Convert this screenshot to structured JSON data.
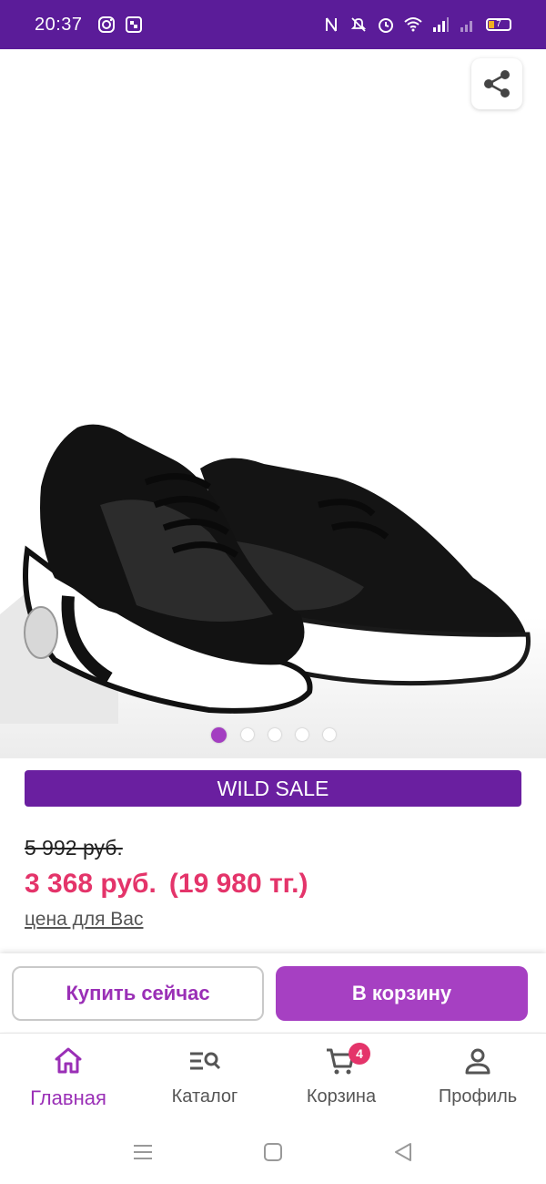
{
  "status_bar": {
    "time": "20:37",
    "battery": "7"
  },
  "sale_banner": {
    "label": "WILD SALE"
  },
  "pricing": {
    "old_price": "5 992 руб.",
    "price": "3 368 руб.",
    "price_tenge": "(19 980 тг.)",
    "note": "цена для Вас"
  },
  "gallery": {
    "slide_count": 5,
    "active_slide": 1
  },
  "actions": {
    "buy_now": "Купить сейчас",
    "add_to_cart": "В корзину"
  },
  "bottom_nav": {
    "items": [
      {
        "label": "Главная",
        "icon": "home-icon",
        "active": true
      },
      {
        "label": "Каталог",
        "icon": "catalog-search-icon"
      },
      {
        "label": "Корзина",
        "icon": "cart-icon",
        "badge": "4"
      },
      {
        "label": "Профиль",
        "icon": "profile-icon"
      }
    ]
  },
  "colors": {
    "brand": "#5b1c99",
    "accent": "#a640c2",
    "price": "#e4346a"
  }
}
